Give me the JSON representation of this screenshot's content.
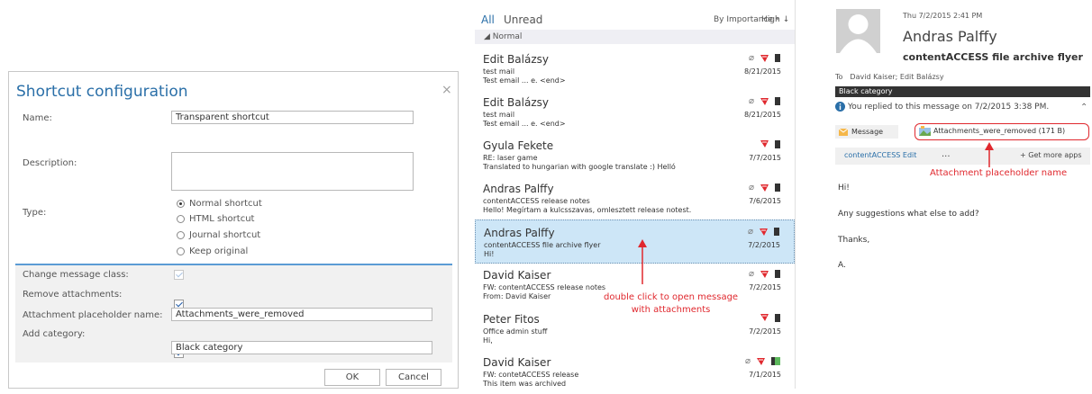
{
  "dialog": {
    "title": "Shortcut configuration",
    "close_glyph": "×",
    "name_label": "Name:",
    "name_value": "Transparent shortcut",
    "description_label": "Description:",
    "description_value": "",
    "type_label": "Type:",
    "type_options": [
      "Normal shortcut",
      "HTML shortcut",
      "Journal shortcut",
      "Keep original"
    ],
    "type_selected": "Normal shortcut",
    "change_class_label": "Change message class:",
    "change_class_checked": true,
    "remove_attachments_label": "Remove attachments:",
    "remove_attachments_checked": true,
    "placeholder_label": "Attachment placeholder name:",
    "placeholder_value": "Attachments_were_removed",
    "add_category_label": "Add category:",
    "add_category_checked": true,
    "category_value": "Black category",
    "ok_label": "OK",
    "cancel_label": "Cancel"
  },
  "list": {
    "tab_all": "All",
    "tab_unread": "Unread",
    "sort_by": "By Importance",
    "sort_by_caret": "▾",
    "sort_dir": "High",
    "sort_dir_arrow": "↓",
    "group_label": "◢ Normal",
    "messages": [
      {
        "from": "Edit Balázsy",
        "subject": "test mail",
        "preview": "Test email ... e. <end>",
        "date": "8/21/2015",
        "attachment": true
      },
      {
        "from": "Edit Balázsy",
        "subject": "test mail",
        "preview": "Test email ... e. <end>",
        "date": "8/21/2015",
        "attachment": true
      },
      {
        "from": "Gyula Fekete",
        "subject": "RE: laser game",
        "preview": "Translated to hungarian with google translate :)  Helló",
        "date": "7/7/2015",
        "attachment": false
      },
      {
        "from": "Andras Palffy",
        "subject": "contentACCESS release notes",
        "preview": "Hello!  Megírtam a kulcsszavas, omlesztett release notest.",
        "date": "7/6/2015",
        "attachment": true
      },
      {
        "from": "Andras Palffy",
        "subject": "contentACCESS file archive flyer",
        "preview": "Hi!",
        "date": "7/2/2015",
        "attachment": true,
        "selected": true
      },
      {
        "from": "David Kaiser",
        "subject": "FW: contentACCESS release notes",
        "preview": "From: David Kaiser",
        "date": "7/2/2015",
        "attachment": true
      },
      {
        "from": "Peter Fitos",
        "subject": "Office admin stuff",
        "preview": "Hi,",
        "date": "7/2/2015",
        "attachment": false
      },
      {
        "from": "David Kaiser",
        "subject": "FW: contetACCESS release",
        "preview": "This item was archived",
        "date": "7/1/2015",
        "attachment": true
      }
    ],
    "annotation": "double click to open message\nwith attachments"
  },
  "pane": {
    "datetime": "Thu 7/2/2015 2:41 PM",
    "sender": "Andras Palffy",
    "subject": "contentACCESS file archive flyer",
    "to_label": "To",
    "to_value": "David Kaiser;  Edit Balázsy",
    "category": "Black category",
    "replied_note": "You replied to this message on 7/2/2015 3:38 PM.",
    "tab_message": "Message",
    "attachment_name": "Attachments_were_removed (171 B)",
    "app_link": "contentACCESS Edit",
    "more_dots": "...",
    "get_apps": "+ Get more apps",
    "annotation": "Attachment placeholder name",
    "body_lines": [
      "Hi!",
      "Any suggestions what else to add?",
      "Thanks,",
      "A."
    ]
  },
  "colors": {
    "accent": "#2a6fa8",
    "selection": "#cde6f7",
    "annotation_red": "#e0282e",
    "flag_red": "#e0282e"
  }
}
